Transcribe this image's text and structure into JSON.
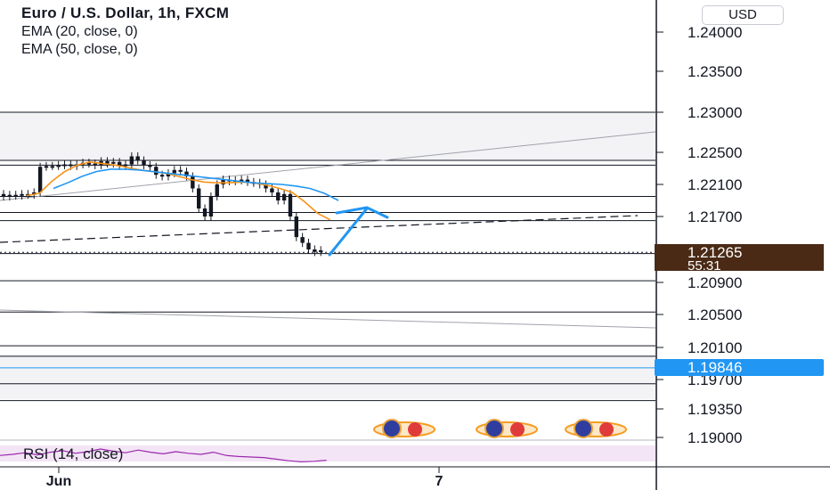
{
  "header": {
    "title": "Euro / U.S. Dollar, 1h, FXCM",
    "ema20": "EMA (20, close, 0)",
    "ema50": "EMA (50, close, 0)",
    "currency": "USD"
  },
  "rsi": {
    "label": "RSI (14, close)"
  },
  "colors": {
    "candle": "#131722",
    "ema20": "#f7931a",
    "ema50": "#2196f3",
    "arrow": "#2196f3",
    "last_price_bg": "#4a2a15",
    "alert_line": "#2196f3",
    "rsi_line": "#9c27b0",
    "rsi_band": "#f3e5f5"
  },
  "chart_data": {
    "type": "candlestick",
    "symbol": "EURUSD",
    "timeframe": "1h",
    "y_ticks": [
      "1.24000",
      "1.23500",
      "1.23000",
      "1.22500",
      "1.22100",
      "1.21700",
      "1.20900",
      "1.20500",
      "1.20100",
      "1.19700",
      "1.19350",
      "1.19000"
    ],
    "x_ticks": [
      "Jun",
      "7"
    ],
    "last_price": {
      "value": "1.21265",
      "countdown": "55:31"
    },
    "alert_price": "1.19846",
    "horizontal_levels": [
      1.23,
      1.224,
      1.2234,
      1.2195,
      1.2175,
      1.2165,
      1.2125,
      1.2092,
      1.2053,
      1.2012,
      1.1999,
      1.1965,
      1.1945
    ],
    "close_series": [
      1.2195,
      1.2197,
      1.2196,
      1.2198,
      1.2197,
      1.22,
      1.2232,
      1.2233,
      1.2233,
      1.2234,
      1.2235,
      1.2233,
      1.2235,
      1.2237,
      1.2236,
      1.2234,
      1.2239,
      1.2236,
      1.2238,
      1.2233,
      1.2235,
      1.2245,
      1.224,
      1.2234,
      1.2232,
      1.2222,
      1.222,
      1.2224,
      1.2228,
      1.2226,
      1.222,
      1.2205,
      1.218,
      1.217,
      1.2195,
      1.221,
      1.2216,
      1.2214,
      1.2215,
      1.2216,
      1.2213,
      1.2212,
      1.221,
      1.2205,
      1.22,
      1.219,
      1.2198,
      1.217,
      1.2145,
      1.2138,
      1.213,
      1.2127,
      1.2129
    ],
    "ema20_series": [
      1.2196,
      1.2199,
      1.2214,
      1.2226,
      1.2234,
      1.2238,
      1.2236,
      1.2234,
      1.2231,
      1.2228,
      1.2226,
      1.2224,
      1.222,
      1.2216,
      1.2213,
      1.2212,
      1.2212,
      1.2213,
      1.2212,
      1.2209,
      1.2205,
      1.22,
      1.2188,
      1.2174,
      1.2166
    ],
    "ema50_series": [
      1.2205,
      1.2212,
      1.222,
      1.2226,
      1.2229,
      1.2229,
      1.2228,
      1.2226,
      1.2224,
      1.2222,
      1.222,
      1.2218,
      1.2216,
      1.2214,
      1.2212,
      1.2211,
      1.221,
      1.2208,
      1.2205,
      1.2199,
      1.219
    ],
    "rsi_series": [
      38,
      40,
      43,
      39,
      44,
      47,
      42,
      45,
      50,
      46,
      43,
      48,
      44,
      41,
      45,
      42,
      40,
      44,
      38,
      36,
      35,
      34,
      31,
      28,
      26,
      27,
      29
    ]
  }
}
